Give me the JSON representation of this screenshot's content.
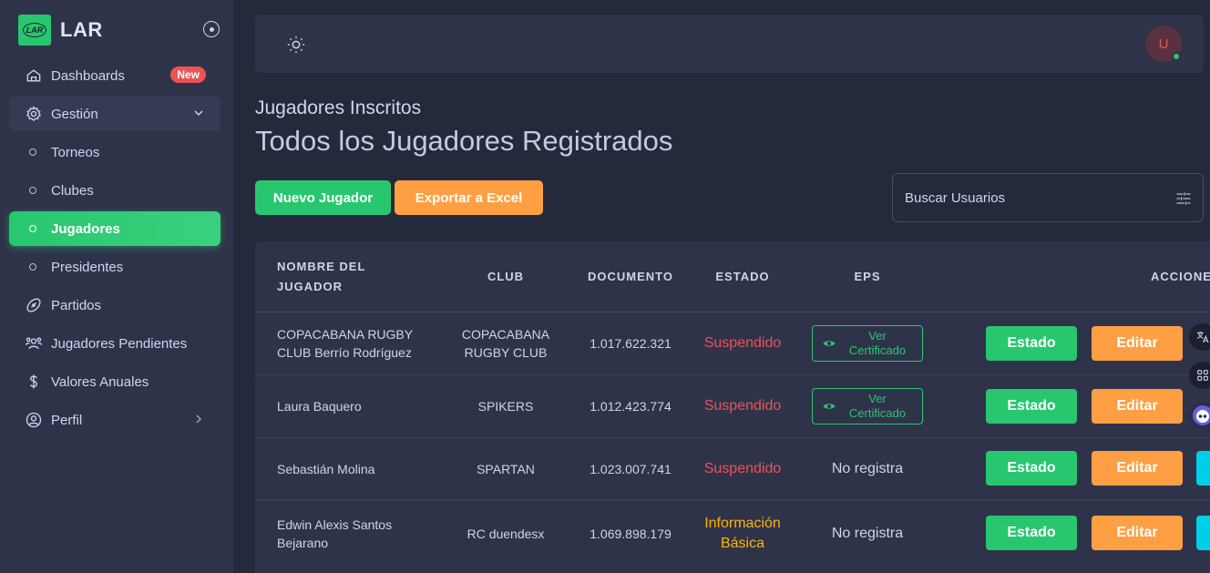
{
  "brand": {
    "name": "LAR",
    "logo_text": "LAR"
  },
  "sidebar": {
    "items": [
      {
        "label": "Dashboards",
        "badge": "New",
        "icon": "home-icon"
      },
      {
        "label": "Gestión",
        "icon": "gear-icon"
      },
      {
        "label": "Torneos"
      },
      {
        "label": "Clubes"
      },
      {
        "label": "Jugadores"
      },
      {
        "label": "Presidentes"
      },
      {
        "label": "Partidos",
        "icon": "rugby-ball-icon"
      },
      {
        "label": "Jugadores Pendientes",
        "icon": "users-icon"
      },
      {
        "label": "Valores Anuales",
        "icon": "dollar-icon"
      },
      {
        "label": "Perfil",
        "icon": "user-circle-icon"
      }
    ]
  },
  "header": {
    "avatar_initial": "U"
  },
  "page": {
    "subtitle": "Jugadores Inscritos",
    "title": "Todos los Jugadores Registrados",
    "new_button": "Nuevo Jugador",
    "export_button": "Exportar a Excel",
    "search_placeholder": "Buscar Usuarios"
  },
  "table": {
    "headers": [
      "NOMBRE DEL JUGADOR",
      "CLUB",
      "DOCUMENTO",
      "ESTADO",
      "EPS",
      "ACCIONES"
    ],
    "cert_label": "Ver Certificado",
    "estado_button": "Estado",
    "edit_button": "Editar",
    "rows": [
      {
        "name": "COPACABANA RUGBY CLUB Berrío Rodríguez",
        "club": "COPACABANA RUGBY CLUB",
        "document": "1.017.622.321",
        "status": "Suspendido",
        "eps": "Ver Certificado"
      },
      {
        "name": "Laura Baquero",
        "club": "SPIKERS",
        "document": "1.012.423.774",
        "status": "Suspendido",
        "eps": "Ver Certificado"
      },
      {
        "name": "Sebastián Molina",
        "club": "SPARTAN",
        "document": "1.023.007.741",
        "status": "Suspendido",
        "eps": "No registra"
      },
      {
        "name": "Edwin Alexis Santos Bejarano",
        "club": "RC duendesx",
        "document": "1.069.898.179",
        "status": "Información Básica",
        "eps": "No registra"
      }
    ]
  },
  "colors": {
    "accent": "#28c76f",
    "orange": "#ff9f43",
    "danger": "#ea5455",
    "warning": "#ffb400",
    "info": "#00cfe8"
  }
}
